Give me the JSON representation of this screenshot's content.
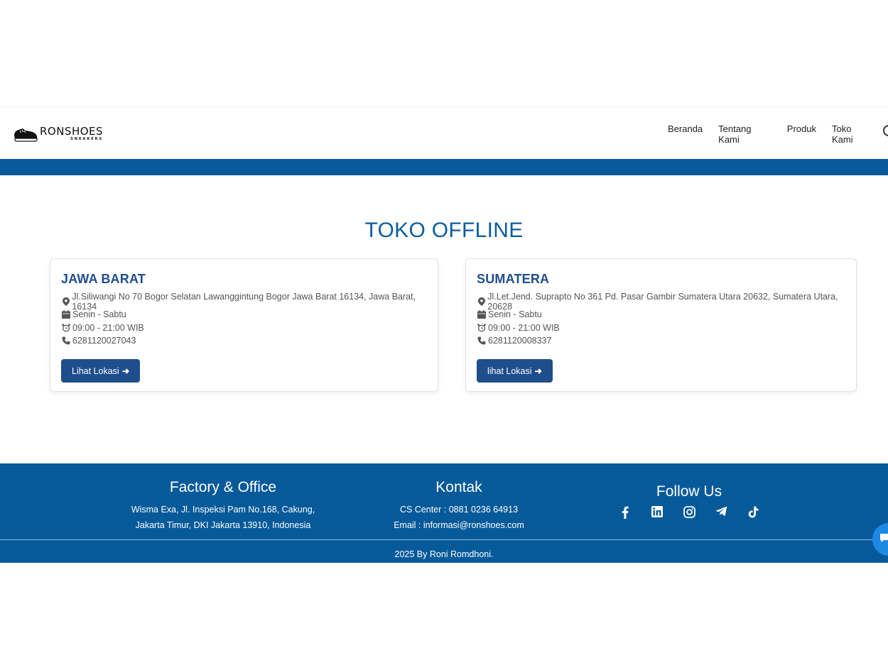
{
  "navbar": {
    "logo_text": "RONSHOES",
    "logo_sub": "SNEAKERS",
    "links": [
      "Beranda",
      "Tentang Kami",
      "Produk",
      "Toko Kami"
    ]
  },
  "main": {
    "title": "TOKO OFFLINE",
    "stores": [
      {
        "region": "JAWA BARAT",
        "address": "Jl.Siliwangi No 70 Bogor Selatan Lawanggintung Bogor Jawa Barat 16134, Jawa Barat, 16134",
        "days": "Senin - Sabtu",
        "hours": "09:00 - 21:00 WIB",
        "phone": "6281120027043",
        "button": "Lihat Lokasi"
      },
      {
        "region": "SUMATERA",
        "address": "Jl.Let.Jend. Suprapto No 361 Pd. Pasar Gambir Sumatera Utara 20632, Sumatera Utara, 20628",
        "days": "Senin - Sabtu",
        "hours": "09:00 - 21:00 WIB",
        "phone": "6281120008337",
        "button": "lihat Lokasi"
      }
    ]
  },
  "footer": {
    "office_title": "Factory & Office",
    "office_line1": "Wisma Exa, Jl. Inspeksi Pam No.168, Cakung,",
    "office_line2": "Jakarta Timur, DKI Jakarta 13910, Indonesia",
    "contact_title": "Kontak",
    "cs_center": "CS Center : 0881 0236 64913",
    "email": "Email : informasi@ronshoes.com",
    "follow_title": "Follow Us",
    "social_icons": [
      "facebook-icon",
      "linkedin-icon",
      "instagram-icon",
      "telegram-icon",
      "tiktok-icon"
    ],
    "copyright": "2025 By Roni Romdhoni."
  },
  "colors": {
    "primary": "#075a99",
    "title": "#0a5d9e",
    "card_heading": "#1f4e8c",
    "button": "#1f4e8c",
    "chat": "#1e88e5"
  }
}
